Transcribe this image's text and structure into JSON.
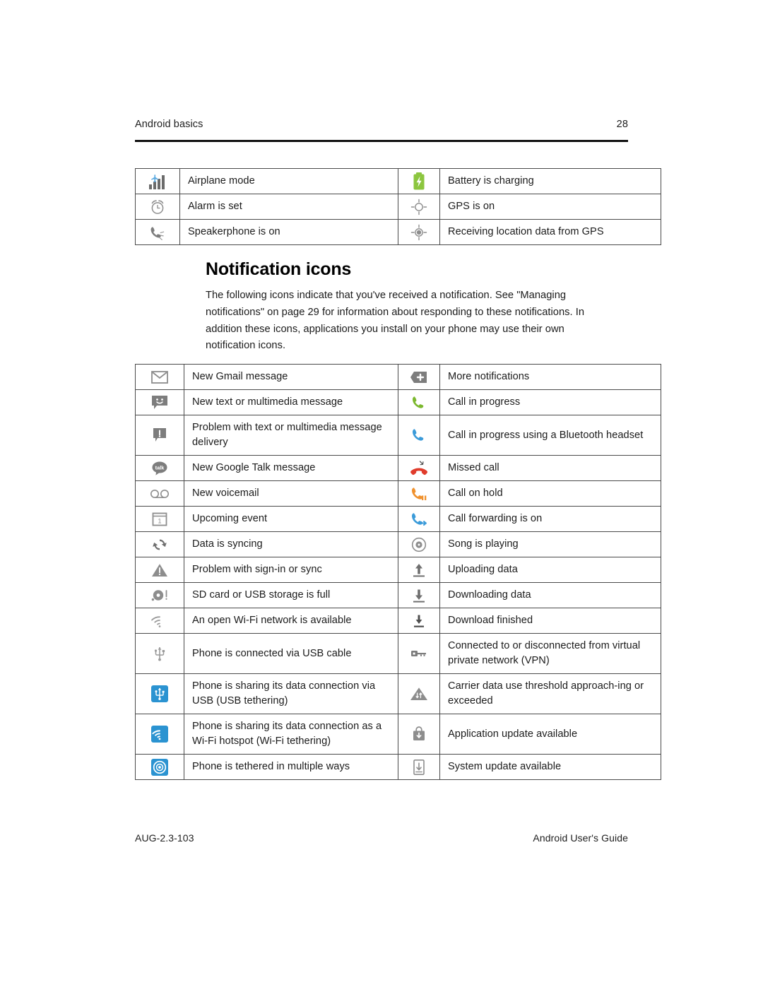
{
  "header": {
    "chapter": "Android basics",
    "page_number": "28"
  },
  "status_table": {
    "rows": [
      [
        {
          "icon": "airplane-mode-icon",
          "label": "Airplane mode"
        },
        {
          "icon": "battery-charging-icon",
          "label": "Battery is charging"
        }
      ],
      [
        {
          "icon": "alarm-clock-icon",
          "label": "Alarm is set"
        },
        {
          "icon": "gps-on-icon",
          "label": "GPS is on"
        }
      ],
      [
        {
          "icon": "speakerphone-icon",
          "label": "Speakerphone is on"
        },
        {
          "icon": "gps-receiving-icon",
          "label": "Receiving location data from GPS"
        }
      ]
    ]
  },
  "section": {
    "title": "Notification icons",
    "paragraph": "The following icons indicate that you've received a notification. See \"Managing notifications\" on page 29 for information about responding to these notifications. In addition these icons, applications you install on your phone may use their own notification icons."
  },
  "notification_table": {
    "rows": [
      [
        {
          "icon": "gmail-icon",
          "label": "New Gmail message"
        },
        {
          "icon": "more-notifications-icon",
          "label": "More notifications"
        }
      ],
      [
        {
          "icon": "sms-message-icon",
          "label": "New text or multimedia message"
        },
        {
          "icon": "call-in-progress-icon",
          "label": "Call in progress"
        }
      ],
      [
        {
          "icon": "message-problem-icon",
          "label": "Problem with text or multimedia message delivery"
        },
        {
          "icon": "call-bluetooth-icon",
          "label": "Call in progress using a Bluetooth headset"
        }
      ],
      [
        {
          "icon": "google-talk-icon",
          "label": "New Google Talk message"
        },
        {
          "icon": "missed-call-icon",
          "label": "Missed call"
        }
      ],
      [
        {
          "icon": "voicemail-icon",
          "label": "New voicemail"
        },
        {
          "icon": "call-on-hold-icon",
          "label": "Call on hold"
        }
      ],
      [
        {
          "icon": "calendar-event-icon",
          "label": "Upcoming event"
        },
        {
          "icon": "call-forwarding-icon",
          "label": "Call forwarding is on"
        }
      ],
      [
        {
          "icon": "sync-icon",
          "label": "Data is syncing"
        },
        {
          "icon": "music-playing-icon",
          "label": "Song is playing"
        }
      ],
      [
        {
          "icon": "sync-problem-icon",
          "label": "Problem with sign-in or sync"
        },
        {
          "icon": "upload-icon",
          "label": "Uploading data"
        }
      ],
      [
        {
          "icon": "sd-card-full-icon",
          "label": "SD card or USB storage is full"
        },
        {
          "icon": "download-icon",
          "label": "Downloading data"
        }
      ],
      [
        {
          "icon": "open-wifi-icon",
          "label": "An open Wi-Fi network is available"
        },
        {
          "icon": "download-finished-icon",
          "label": "Download finished"
        }
      ],
      [
        {
          "icon": "usb-connected-icon",
          "label": "Phone is connected via USB cable"
        },
        {
          "icon": "vpn-icon",
          "label": "Connected to or disconnected from virtual private network (VPN)"
        }
      ],
      [
        {
          "icon": "usb-tethering-icon",
          "label": "Phone is sharing its data connection via USB (USB tethering)"
        },
        {
          "icon": "carrier-data-threshold-icon",
          "label": "Carrier data use threshold approach-ing or exceeded"
        }
      ],
      [
        {
          "icon": "wifi-tethering-icon",
          "label": "Phone is sharing its data connection as a Wi-Fi hotspot (Wi-Fi tethering)"
        },
        {
          "icon": "app-update-icon",
          "label": "Application update available"
        }
      ],
      [
        {
          "icon": "multiple-tethering-icon",
          "label": "Phone is tethered in multiple ways"
        },
        {
          "icon": "system-update-icon",
          "label": "System update available"
        }
      ]
    ]
  },
  "footer": {
    "document_code": "AUG-2.3-103",
    "guide_title": "Android User's Guide"
  },
  "colors": {
    "battery_green": "#8cc63f",
    "call_green": "#7cb82f",
    "call_blue": "#3b9bd9",
    "call_orange": "#f0912d",
    "missed_red": "#e03c2c",
    "tile_blue": "#2b93d1",
    "icon_gray": "#6f6f6f",
    "plane_blue": "#5aa9e0"
  }
}
